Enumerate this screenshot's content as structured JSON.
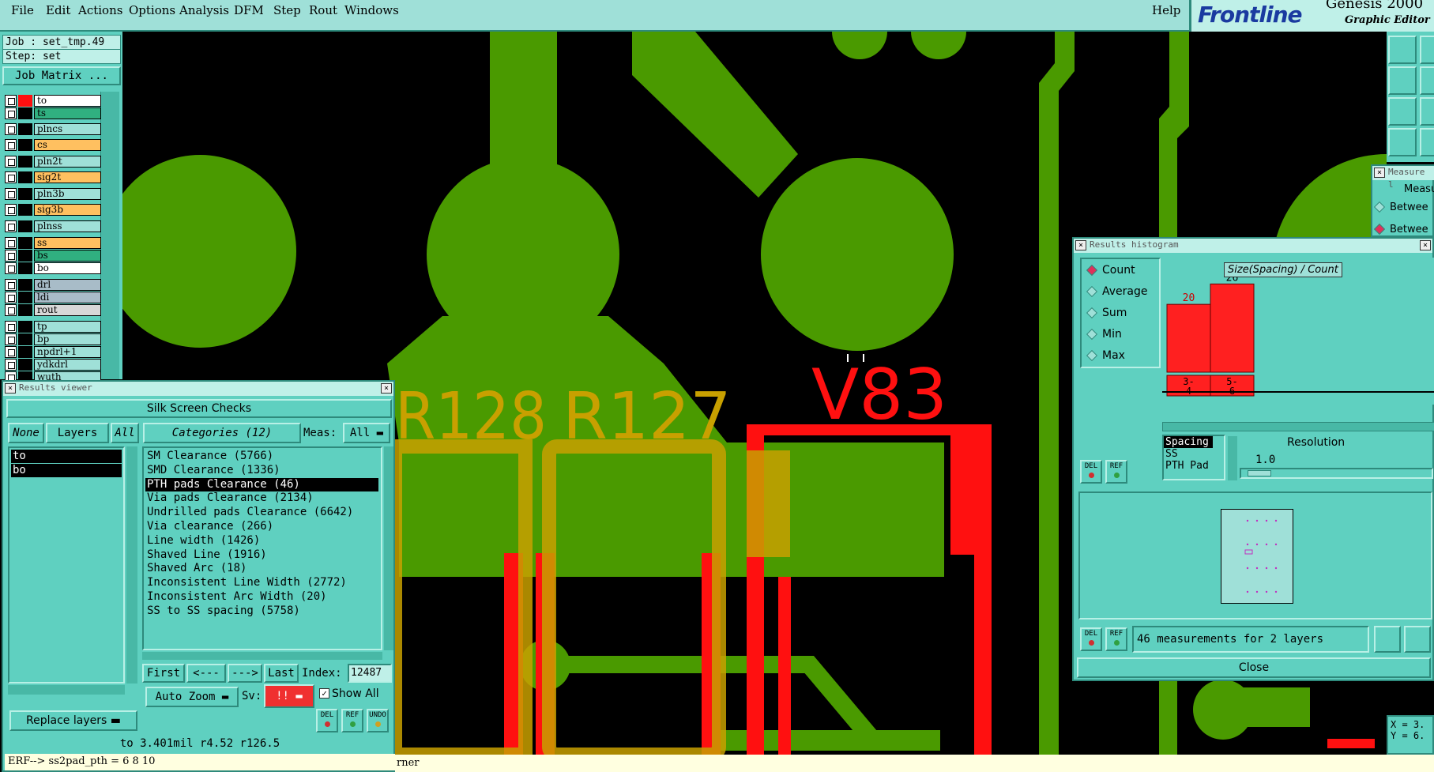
{
  "menubar": {
    "items": [
      "File",
      "Edit",
      "Actions",
      "Options",
      "Analysis",
      "DFM",
      "Step",
      "Rout",
      "Windows"
    ],
    "help": "Help",
    "brand": "Frontline",
    "product": "Genesis 2000",
    "subtitle": "Graphic Editor"
  },
  "job": {
    "job_line": "Job : set_tmp.49",
    "step_line": "Step: set",
    "matrix_button": "Job Matrix ..."
  },
  "layers": [
    {
      "name": "to",
      "color": "#ffffff"
    },
    {
      "name": "ts",
      "color": "#30b080"
    },
    {
      "name": "plncs",
      "color": "#9fe0d8"
    },
    {
      "name": "cs",
      "color": "#ffc060"
    },
    {
      "name": "pln2t",
      "color": "#9fe0d8"
    },
    {
      "name": "sig2t",
      "color": "#ffc060"
    },
    {
      "name": "pln3b",
      "color": "#9fe0d8"
    },
    {
      "name": "sig3b",
      "color": "#ffc060"
    },
    {
      "name": "plnss",
      "color": "#9fe0d8"
    },
    {
      "name": "ss",
      "color": "#ffc060"
    },
    {
      "name": "bs",
      "color": "#30b080"
    },
    {
      "name": "bo",
      "color": "#ffffff"
    },
    {
      "name": "drl",
      "color": "#a8bcc8"
    },
    {
      "name": "ldi",
      "color": "#a8bcc8"
    },
    {
      "name": "rout",
      "color": "#d8d8d8"
    },
    {
      "name": "tp",
      "color": "#9fe0d8"
    },
    {
      "name": "bp",
      "color": "#9fe0d8"
    },
    {
      "name": "npdrl+1",
      "color": "#9fe0d8"
    },
    {
      "name": "ydkdrl",
      "color": "#9fe0d8"
    },
    {
      "name": "wuth",
      "color": "#9fe0d8"
    }
  ],
  "pcb_labels": [
    "R128",
    "R127",
    "V83"
  ],
  "results_viewer": {
    "title": "Results viewer",
    "header": "Silk Screen Checks",
    "none_btn": "None",
    "layers_btn": "Layers",
    "all_btn": "All",
    "categories_btn": "Categories (12)",
    "meas_label": "Meas:",
    "meas_value": "All",
    "layer_items": [
      "to",
      "bo"
    ],
    "categories": [
      "SM Clearance (5766)",
      "SMD Clearance (1336)",
      "PTH pads Clearance (46)",
      "Via pads Clearance (2134)",
      "Undrilled pads Clearance (6642)",
      "Via clearance (266)",
      "Line width (1426)",
      "Shaved Line (1916)",
      "Shaved Arc (18)",
      "Inconsistent Line Width (2772)",
      "Inconsistent Arc Width (20)",
      "SS to SS spacing (5758)"
    ],
    "selected_index": 2,
    "first_btn": "First",
    "prev_btn": "<---",
    "next_btn": "--->",
    "last_btn": "Last",
    "index_label": "Index:",
    "index_value": "12487",
    "zoom_btn": "Auto Zoom",
    "sv_label": "Sv:",
    "sv_value": "!!",
    "show_all": "Show All",
    "replace_btn": "Replace layers",
    "del": "DEL",
    "ref": "REF",
    "undo": "UNDO",
    "status_line": "to 3.401mil  r4.52  r126.5",
    "erf_line": "ERF--> ss2pad_pth = 6 8 10"
  },
  "histogram": {
    "title": "Results histogram",
    "radios": [
      "Count",
      "Average",
      "Sum",
      "Min",
      "Max"
    ],
    "selected_radio": 0,
    "chart_title": "Size(Spacing) / Count",
    "bars": [
      {
        "label_top": "3-",
        "label_bot": "4",
        "count": 20
      },
      {
        "label_top": "5-",
        "label_bot": "6",
        "count": 26
      }
    ],
    "attr_list": [
      "Spacing",
      "SS",
      "PTH Pad"
    ],
    "resolution_label": "Resolution",
    "resolution_value": "1.0",
    "summary": "46 measurements for 2 layers",
    "close_btn": "Close",
    "del": "DEL",
    "ref": "REF"
  },
  "measure_window": {
    "title": "Measure l",
    "header": "Measu",
    "opt1": "Betwee",
    "opt2": "Betwee"
  },
  "coords": {
    "x": "X = 3.",
    "y": "Y = 6."
  },
  "status_bar": "rner",
  "colors": {
    "copper": "#4a9a00",
    "silk": "#c8a000",
    "red": "#ff1010",
    "teal": "#5fd0c0"
  }
}
